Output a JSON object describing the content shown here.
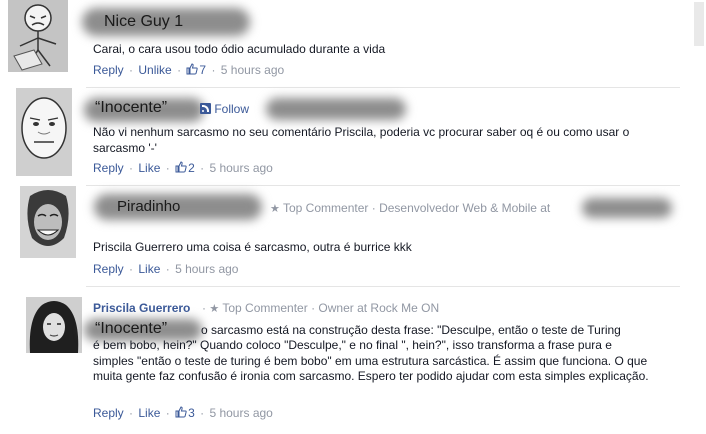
{
  "comments": [
    {
      "drawn_name": "Nice Guy 1",
      "text": "Carai, o cara usou todo ódio acumulado durante a vida",
      "actions": {
        "reply": "Reply",
        "like": "Unlike",
        "likes": "7",
        "time": "5 hours ago"
      }
    },
    {
      "drawn_name": "“Inocente”",
      "follow": "Follow",
      "text": "Não vi nenhum sarcasmo no seu comentário Priscila, poderia vc procurar saber oq é ou como usar o sarcasmo '-'",
      "actions": {
        "reply": "Reply",
        "like": "Like",
        "likes": "2",
        "time": "5 hours ago"
      }
    },
    {
      "drawn_name": "Piradinho",
      "badge": "Top Commenter",
      "job": "Desenvolvedor Web & Mobile at",
      "text": "Priscila Guerrero uma coisa é sarcasmo, outra é burrice kkk",
      "actions": {
        "reply": "Reply",
        "like": "Like",
        "time": "5 hours ago"
      }
    },
    {
      "author": "Priscila Guerrero",
      "badge": "Top Commenter",
      "job": "Owner at Rock Me ON",
      "drawn_mention": "“Inocente”",
      "text_first": "o sarcasmo está na construção desta frase: \"Desculpe, então o teste de Turing",
      "text_rest": "é bem bobo, hein?\" Quando coloco \"Desculpe,\" e no final \", hein?\", isso transforma a frase pura e simples \"então o teste de turing é bem bobo\" em uma estrutura sarcástica. É assim que funciona. O que muita gente faz confusão é ironia com sarcasmo. Espero ter podido ajudar com esta simples explicação.",
      "actions": {
        "reply": "Reply",
        "like": "Like",
        "likes": "3",
        "time": "5 hours ago"
      }
    }
  ],
  "colors": {
    "link": "#3b5998",
    "meta": "#9197a3",
    "text": "#141823"
  }
}
